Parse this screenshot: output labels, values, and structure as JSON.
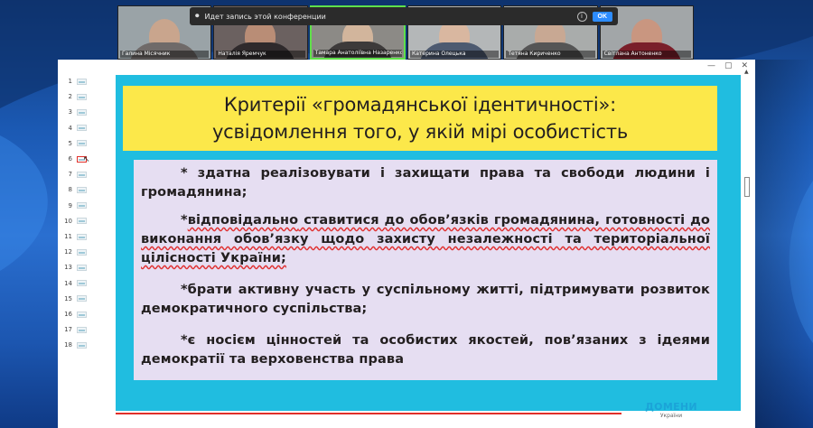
{
  "conference": {
    "recording_text": "Идет запись этой конференции",
    "ok_label": "OK",
    "participants": [
      {
        "name": "Галина Місячник"
      },
      {
        "name": "Наталія Яремчук"
      },
      {
        "name": "Тамара Анатоліївна Назаренко"
      },
      {
        "name": "Катерина Олецька"
      },
      {
        "name": "Тетяна Кириченко"
      },
      {
        "name": "Світлана Антоненко"
      }
    ]
  },
  "window": {
    "controls": [
      "—",
      "▢",
      "✕"
    ]
  },
  "thumbnails": [
    "1",
    "2",
    "3",
    "4",
    "5",
    "6",
    "7",
    "8",
    "9",
    "10",
    "11",
    "12",
    "13",
    "14",
    "15",
    "16",
    "17",
    "18"
  ],
  "selected_slide": 6,
  "slide": {
    "title_lines": [
      "Критерії «громадянської ідентичності»:",
      "усвідомлення того, у якій мірі особистість"
    ],
    "paragraphs": [
      {
        "prefix": "* здатна реалізовувати і захищати права та свободи людини і громадянина;",
        "underlined": "",
        "rest": ""
      },
      {
        "prefix": "*",
        "underlined": "відповідально",
        "rest": " ставитися до обов’язків громадянина, готовності до виконання обов’язку щодо захисту незалежності та територіальної цілісності України;"
      },
      {
        "prefix": "*брати активну участь у суспільному житті, підтримувати розвиток демократичного суспільства;",
        "underlined": "",
        "rest": ""
      },
      {
        "prefix": "*є носієм цінностей та особистих якостей, пов’язаних з ідеями демократії та верховенства права",
        "underlined": "",
        "rest": ""
      }
    ],
    "logo_main": "ДОМЕНИ",
    "logo_sub": "України"
  },
  "colors": {
    "slide_frame": "#20bde0",
    "title_box": "#fce84a",
    "body_box": "#e6def2",
    "accent_line": "#e0302a",
    "active_speaker": "#5fe04a"
  }
}
